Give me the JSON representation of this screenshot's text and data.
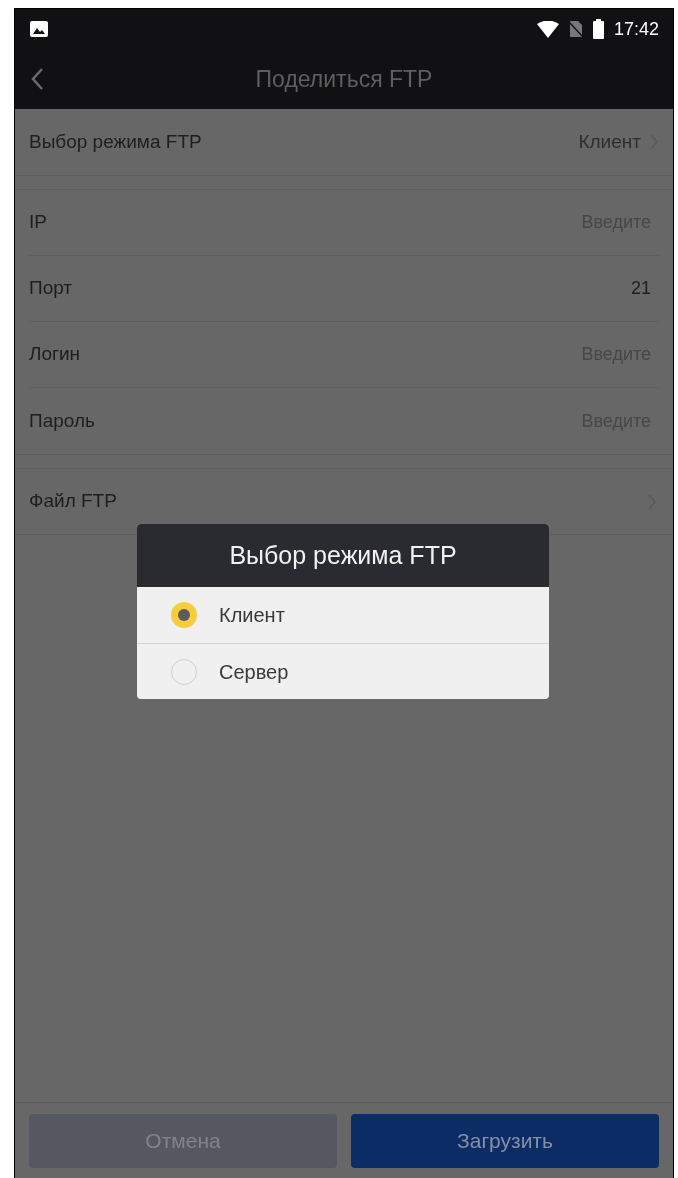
{
  "status_bar": {
    "time": "17:42"
  },
  "header": {
    "title": "Поделиться FTP"
  },
  "settings_groups": [
    {
      "rows": [
        {
          "kind": "select",
          "label": "Выбор режима FTP",
          "value": "Клиент"
        }
      ]
    },
    {
      "rows": [
        {
          "kind": "input",
          "label": "IP",
          "placeholder": "Введите"
        },
        {
          "kind": "input",
          "label": "Порт",
          "value": "21"
        },
        {
          "kind": "input",
          "label": "Логин",
          "placeholder": "Введите"
        },
        {
          "kind": "input",
          "label": "Пароль",
          "placeholder": "Введите"
        }
      ]
    },
    {
      "rows": [
        {
          "kind": "link",
          "label": "Файл FTP"
        }
      ]
    }
  ],
  "dialog": {
    "title": "Выбор режима FTP",
    "options": [
      {
        "label": "Клиент",
        "selected": true
      },
      {
        "label": "Сервер",
        "selected": false
      }
    ]
  },
  "buttons": [
    {
      "kind": "secondary",
      "label": "Отмена",
      "disabled": true
    },
    {
      "kind": "primary",
      "label": "Загрузить",
      "disabled": false
    }
  ]
}
